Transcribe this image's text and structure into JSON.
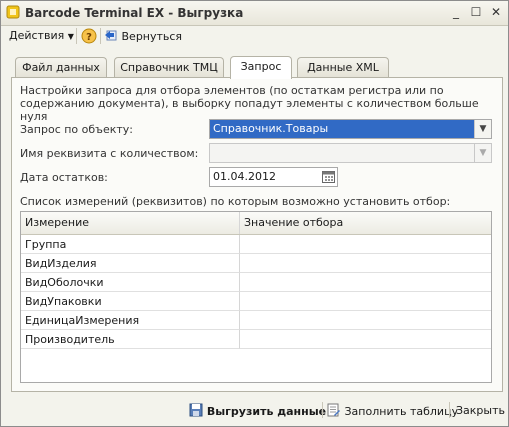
{
  "window": {
    "title": "Barcode Terminal EX - Выгрузка"
  },
  "toolbar": {
    "actions_label": "Действия",
    "back_label": "Вернуться"
  },
  "tabs": [
    {
      "label": "Файл данных"
    },
    {
      "label": "Справочник ТМЦ"
    },
    {
      "label": "Запрос"
    },
    {
      "label": "Данные XML"
    }
  ],
  "panel": {
    "description": "Настройки запроса для отбора элементов (по остаткам регистра или по содержанию документа), в выборку попадут элементы с количеством больше нуля",
    "query_label": "Запрос по объекту:",
    "query_value": "Справочник.Товары",
    "attr_label": "Имя реквизита с количеством:",
    "attr_value": "",
    "date_label": "Дата остатков:",
    "date_value": "01.04.2012",
    "list_caption": "Список измерений (реквизитов) по которым возможно установить отбор:"
  },
  "grid": {
    "columns": [
      "Измерение",
      "Значение отбора"
    ],
    "rows": [
      [
        "Группа",
        ""
      ],
      [
        "ВидИзделия",
        ""
      ],
      [
        "ВидОболочки",
        ""
      ],
      [
        "ВидУпаковки",
        ""
      ],
      [
        "ЕдиницаИзмерения",
        ""
      ],
      [
        "Производитель",
        ""
      ]
    ]
  },
  "bottom": {
    "export_label": "Выгрузить данные",
    "fill_label": "Заполнить таблицу",
    "close_label": "Закрыть"
  }
}
